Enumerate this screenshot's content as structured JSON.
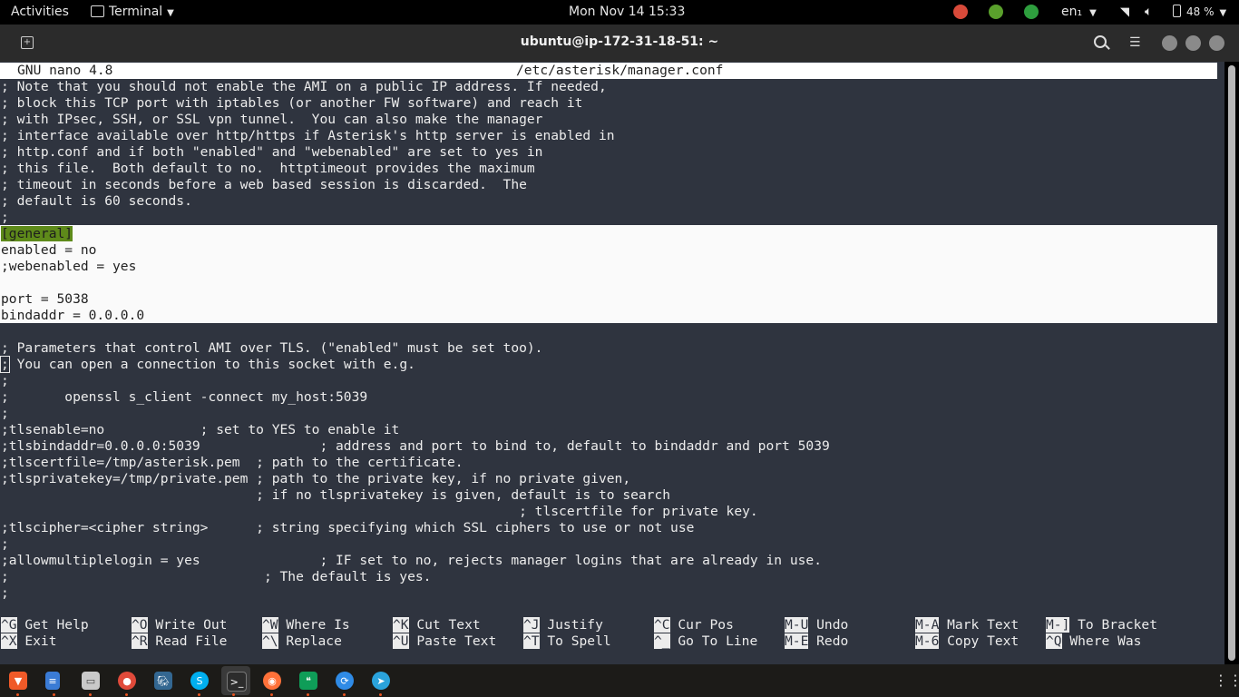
{
  "topbar": {
    "activities": "Activities",
    "app_name": "Terminal",
    "clock": "Mon Nov 14  15:33",
    "lang": "en₁",
    "battery": "48 %"
  },
  "window": {
    "title": "ubuntu@ip-172-31-18-51: ~"
  },
  "nano": {
    "version": "GNU nano 4.8",
    "filename": "/etc/asterisk/manager.conf",
    "lines": [
      "; Note that you should not enable the AMI on a public IP address. If needed,",
      "; block this TCP port with iptables (or another FW software) and reach it",
      "; with IPsec, SSH, or SSL vpn tunnel.  You can also make the manager",
      "; interface available over http/https if Asterisk's http server is enabled in",
      "; http.conf and if both \"enabled\" and \"webenabled\" are set to yes in",
      "; this file.  Both default to no.  httptimeout provides the maximum",
      "; timeout in seconds before a web based session is discarded.  The",
      "; default is 60 seconds.",
      ";",
      "[general]",
      "enabled = no",
      ";webenabled = yes",
      "",
      "port = 5038",
      "bindaddr = 0.0.0.0",
      "",
      "; Parameters that control AMI over TLS. (\"enabled\" must be set too).",
      "; You can open a connection to this socket with e.g.",
      ";",
      ";       openssl s_client -connect my_host:5039",
      ";",
      ";tlsenable=no            ; set to YES to enable it",
      ";tlsbindaddr=0.0.0.0:5039               ; address and port to bind to, default to bindaddr and port 5039",
      ";tlscertfile=/tmp/asterisk.pem  ; path to the certificate.",
      ";tlsprivatekey=/tmp/private.pem ; path to the private key, if no private given,",
      "                                ; if no tlsprivatekey is given, default is to search",
      "                                                                 ; tlscertfile for private key.",
      ";tlscipher=<cipher string>      ; string specifying which SSL ciphers to use or not use",
      ";",
      ";allowmultiplelogin = yes               ; IF set to no, rejects manager logins that are already in use.",
      ";                                ; The default is yes.",
      ";"
    ],
    "shortcuts": [
      {
        "key": "^G",
        "label": "Get Help"
      },
      {
        "key": "^X",
        "label": "Exit"
      },
      {
        "key": "^O",
        "label": "Write Out"
      },
      {
        "key": "^R",
        "label": "Read File"
      },
      {
        "key": "^W",
        "label": "Where Is"
      },
      {
        "key": "^\\",
        "label": "Replace"
      },
      {
        "key": "^K",
        "label": "Cut Text"
      },
      {
        "key": "^U",
        "label": "Paste Text"
      },
      {
        "key": "^J",
        "label": "Justify"
      },
      {
        "key": "^T",
        "label": "To Spell"
      },
      {
        "key": "^C",
        "label": "Cur Pos"
      },
      {
        "key": "^_",
        "label": "Go To Line"
      },
      {
        "key": "M-U",
        "label": "Undo"
      },
      {
        "key": "M-E",
        "label": "Redo"
      },
      {
        "key": "M-A",
        "label": "Mark Text"
      },
      {
        "key": "M-6",
        "label": "Copy Text"
      },
      {
        "key": "M-]",
        "label": "To Bracket"
      },
      {
        "key": "^Q",
        "label": "Where Was"
      }
    ]
  },
  "dock": {
    "items": [
      "brave-icon",
      "text-editor-icon",
      "files-icon",
      "chrome-icon",
      "pgadmin-icon",
      "skype-icon",
      "terminal-icon",
      "firefox-icon",
      "hangouts-icon",
      "sync-icon",
      "telegram-icon"
    ],
    "apps_grid_icon": "apps-grid-icon"
  }
}
